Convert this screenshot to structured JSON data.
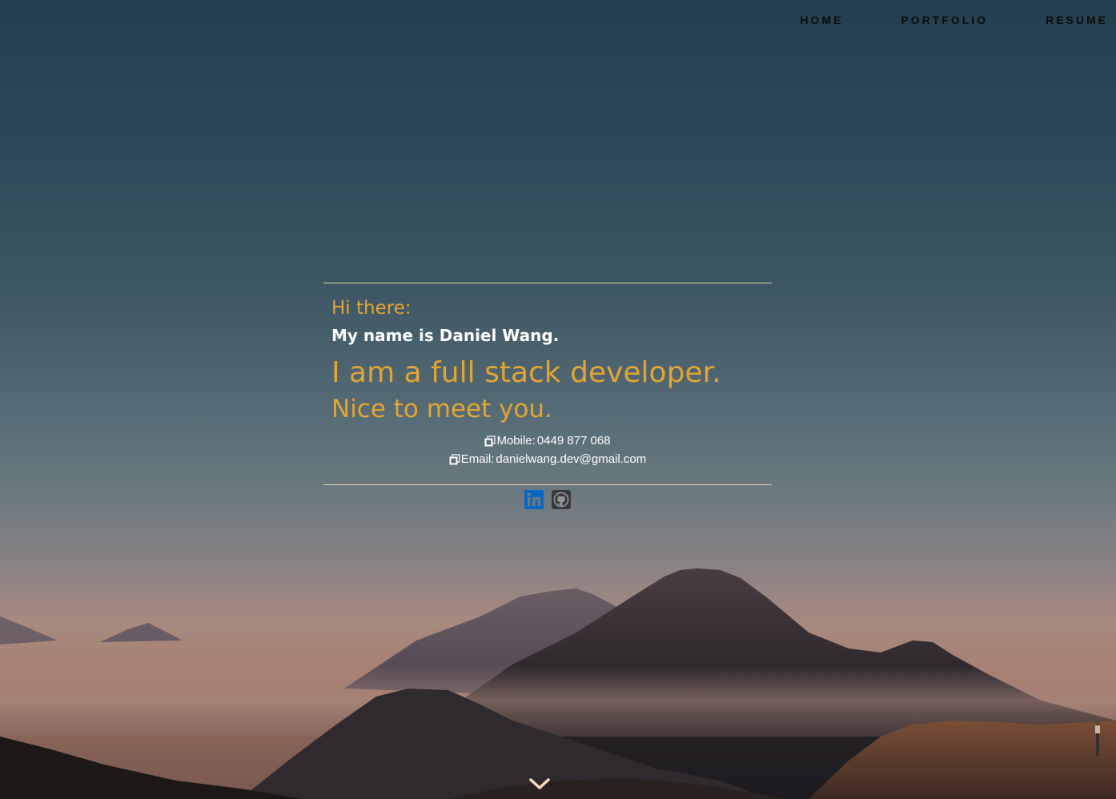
{
  "nav": {
    "items": [
      {
        "label": "HOME"
      },
      {
        "label": "PORTFOLIO"
      },
      {
        "label": "RESUME"
      }
    ]
  },
  "intro": {
    "greeting": "Hi there:",
    "name": "My name is Daniel Wang.",
    "role": "I am a full stack developer.",
    "closing": "Nice to meet you.",
    "accent_color": "#e4a432",
    "rule_color": "#e4d3a7"
  },
  "contact": {
    "mobile_label": "Mobile:",
    "mobile_value": "0449 877 068",
    "email_label": "Email:",
    "email_value": "danielwang.dev@gmail.com",
    "copy_icon": "copy-icon"
  },
  "social": {
    "linkedin": {
      "icon": "linkedin-icon",
      "color": "#0a66c2"
    },
    "github": {
      "icon": "github-icon",
      "color": "#3a3a3a"
    }
  },
  "scroll": {
    "icon": "chevron-down-icon",
    "color": "#f4dcc0"
  }
}
